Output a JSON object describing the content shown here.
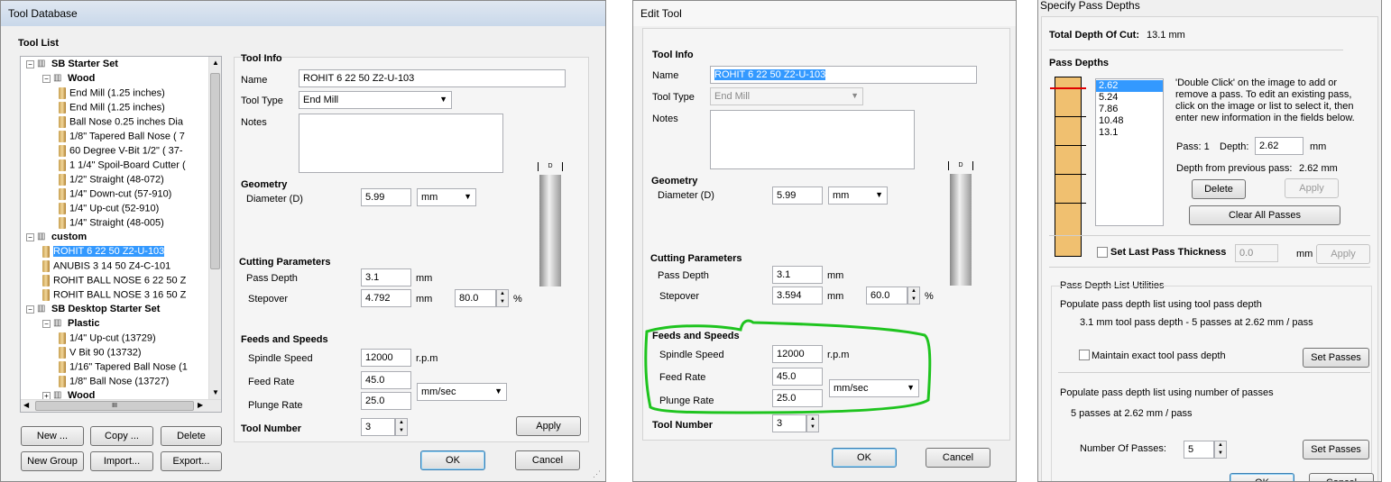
{
  "tool_database": {
    "title": "Tool Database",
    "tool_list_label": "Tool List",
    "tree": [
      {
        "level": 0,
        "kind": "group",
        "label": "SB Starter Set",
        "expander": "−"
      },
      {
        "level": 1,
        "kind": "group",
        "label": "Wood",
        "expander": "−"
      },
      {
        "level": 2,
        "kind": "tool",
        "label": "End Mill (1.25 inches)"
      },
      {
        "level": 2,
        "kind": "tool",
        "label": "End Mill (1.25 inches)"
      },
      {
        "level": 2,
        "kind": "tool",
        "label": "Ball Nose 0.25 inches Dia"
      },
      {
        "level": 2,
        "kind": "tool",
        "label": "1/8\" Tapered Ball Nose ( 7"
      },
      {
        "level": 2,
        "kind": "tool",
        "label": "60 Degree V-Bit 1/2\"  ( 37-"
      },
      {
        "level": 2,
        "kind": "tool",
        "label": "1 1/4\" Spoil-Board Cutter ("
      },
      {
        "level": 2,
        "kind": "tool",
        "label": "1/2\" Straight  (48-072)"
      },
      {
        "level": 2,
        "kind": "tool",
        "label": "1/4\"  Down-cut (57-910)"
      },
      {
        "level": 2,
        "kind": "tool",
        "label": "1/4\" Up-cut (52-910)"
      },
      {
        "level": 2,
        "kind": "tool",
        "label": "1/4\" Straight  (48-005)"
      },
      {
        "level": 0,
        "kind": "group",
        "label": "custom",
        "expander": "−"
      },
      {
        "level": 1,
        "kind": "tool",
        "label": "ROHIT 6 22 50   Z2-U-103",
        "selected": true
      },
      {
        "level": 1,
        "kind": "tool",
        "label": "ANUBIS 3  14 50    Z4-C-101"
      },
      {
        "level": 1,
        "kind": "tool",
        "label": "ROHIT BALL NOSE 6 22 50   Z"
      },
      {
        "level": 1,
        "kind": "tool",
        "label": "ROHIT BALL NOSE 3 16 50   Z"
      },
      {
        "level": 0,
        "kind": "group",
        "label": "SB Desktop Starter Set",
        "expander": "−"
      },
      {
        "level": 1,
        "kind": "group",
        "label": "Plastic",
        "expander": "−"
      },
      {
        "level": 2,
        "kind": "tool",
        "label": "1/4\" Up-cut (13729)"
      },
      {
        "level": 2,
        "kind": "tool",
        "label": "V Bit 90 (13732)"
      },
      {
        "level": 2,
        "kind": "tool",
        "label": "1/16\" Tapered Ball Nose (1"
      },
      {
        "level": 2,
        "kind": "tool",
        "label": "1/8\" Ball Nose (13727)"
      },
      {
        "level": 1,
        "kind": "group",
        "label": "Wood",
        "expander": "+"
      }
    ],
    "hscroll_grip": "III",
    "buttons": {
      "new": "New ...",
      "copy": "Copy ...",
      "delete": "Delete",
      "new_group": "New Group",
      "import": "Import...",
      "export": "Export...",
      "apply": "Apply",
      "ok": "OK",
      "cancel": "Cancel"
    },
    "tool_info": {
      "heading": "Tool Info",
      "name_label": "Name",
      "name": "ROHIT 6 22 50   Z2-U-103",
      "type_label": "Tool Type",
      "type": "End Mill",
      "notes_label": "Notes"
    },
    "geometry": {
      "heading": "Geometry",
      "diameter_label": "Diameter (D)",
      "diameter": "5.99",
      "units": "mm",
      "d_marker": "D"
    },
    "cutting": {
      "heading": "Cutting Parameters",
      "pass_depth_label": "Pass Depth",
      "pass_depth": "3.1",
      "pass_unit": "mm",
      "stepover_label": "Stepover",
      "stepover": "4.792",
      "stepover_unit": "mm",
      "stepover_pct": "80.0",
      "pct": "%"
    },
    "feeds": {
      "heading": "Feeds and Speeds",
      "spindle_label": "Spindle Speed",
      "spindle": "12000",
      "spindle_unit": "r.p.m",
      "feed_label": "Feed Rate",
      "feed": "45.0",
      "plunge_label": "Plunge Rate",
      "plunge": "25.0",
      "rate_units": "mm/sec"
    },
    "tool_number": {
      "label": "Tool Number",
      "value": "3"
    }
  },
  "edit_tool": {
    "title": "Edit Tool",
    "tool_info": {
      "heading": "Tool Info",
      "name_label": "Name",
      "name": "ROHIT 6 22 50   Z2-U-103",
      "type_label": "Tool Type",
      "type": "End Mill",
      "notes_label": "Notes"
    },
    "geometry": {
      "heading": "Geometry",
      "diameter_label": "Diameter (D)",
      "diameter": "5.99",
      "units": "mm",
      "d_marker": "D"
    },
    "cutting": {
      "heading": "Cutting Parameters",
      "pass_depth_label": "Pass Depth",
      "pass_depth": "3.1",
      "pass_unit": "mm",
      "stepover_label": "Stepover",
      "stepover": "3.594",
      "stepover_unit": "mm",
      "stepover_pct": "60.0",
      "pct": "%"
    },
    "feeds": {
      "heading": "Feeds and Speeds",
      "spindle_label": "Spindle Speed",
      "spindle": "12000",
      "spindle_unit": "r.p.m",
      "feed_label": "Feed Rate",
      "feed": "45.0",
      "plunge_label": "Plunge Rate",
      "plunge": "25.0",
      "rate_units": "mm/sec"
    },
    "tool_number": {
      "label": "Tool Number",
      "value": "3"
    },
    "buttons": {
      "ok": "OK",
      "cancel": "Cancel"
    },
    "highlight_color": "#1fc41f"
  },
  "pass_depths": {
    "title": "Specify Pass Depths",
    "total_label": "Total Depth Of Cut:",
    "total_value": "13.1 mm",
    "pass_depths_heading": "Pass Depths",
    "list": [
      "2.62",
      "5.24",
      "7.86",
      "10.48",
      "13.1"
    ],
    "selected_index": 0,
    "instructions": "'Double Click' on the image to add or remove a pass. To edit an existing pass, click on the image or list to select it, then enter new information in the fields below.",
    "pass_label": "Pass: 1",
    "depth_label": "Depth:",
    "depth_value": "2.62",
    "depth_unit": "mm",
    "from_prev_label": "Depth from previous pass:",
    "from_prev_value": "2.62 mm",
    "buttons": {
      "delete": "Delete",
      "apply": "Apply",
      "clear_all": "Clear All Passes",
      "apply2": "Apply",
      "set_passes_1": "Set Passes",
      "set_passes_2": "Set Passes",
      "ok": "OK",
      "cancel": "Cancel"
    },
    "set_last_label": "Set Last Pass Thickness",
    "set_last_value": "0.0",
    "set_last_unit": "mm",
    "utilities_heading": "Pass Depth List Utilities",
    "populate_tool_label": "Populate pass depth list using tool pass depth",
    "populate_tool_summary": "3.1 mm tool pass depth - 5 passes at 2.62 mm / pass",
    "maintain_label": "Maintain exact tool pass depth",
    "populate_number_label": "Populate pass depth list using number of passes",
    "populate_number_summary": "5 passes at 2.62 mm / pass",
    "num_passes_label": "Number Of Passes:",
    "num_passes_value": "5",
    "pass_fractions": [
      0.2,
      0.4,
      0.6,
      0.8,
      1.0
    ],
    "selected_pass_color": "#e00000",
    "material_color": "#f0c070"
  }
}
